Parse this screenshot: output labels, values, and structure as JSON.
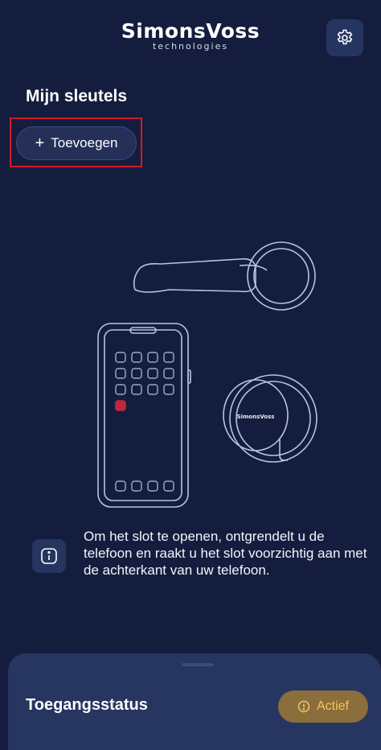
{
  "header": {
    "brand_main": "SimonsVoss",
    "brand_sub": "technologies",
    "settings_icon": "gear-icon"
  },
  "main": {
    "title": "Mijn sleutels",
    "add_button": {
      "icon": "plus-icon",
      "label": "Toevoegen"
    },
    "illustration": {
      "cylinder_brand": "SimonsVoss"
    },
    "info": {
      "icon": "info-icon",
      "text": "Om het slot te openen, ontgrendelt u de telefoon en raakt u het slot voorzichtig aan met de achterkant van uw telefoon."
    }
  },
  "bottom_sheet": {
    "title": "Toegangsstatus",
    "status": {
      "icon": "alert-circle-icon",
      "label": "Actief"
    }
  },
  "colors": {
    "background": "#141d3d",
    "card": "#263460",
    "highlight": "#d11a2a",
    "status_bg": "#8a6e3b",
    "status_fg": "#f5c56a"
  }
}
